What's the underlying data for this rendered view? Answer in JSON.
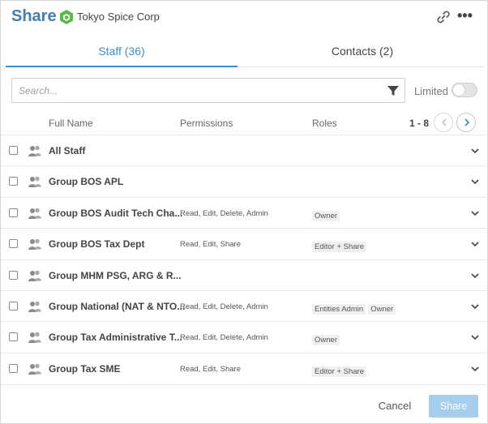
{
  "header": {
    "title": "Share",
    "org_name": "Tokyo Spice Corp",
    "org_icon": "hexagon-icon",
    "link_icon": "link-icon",
    "more_icon": "more-icon",
    "more_glyph": "•••"
  },
  "tabs": [
    {
      "label": "Staff (36)",
      "active": true
    },
    {
      "label": "Contacts (2)",
      "active": false
    }
  ],
  "search": {
    "placeholder": "Search...",
    "value": ""
  },
  "limited": {
    "label": "Limited",
    "on": false
  },
  "columns": {
    "name": "Full Name",
    "permissions": "Permissions",
    "roles": "Roles"
  },
  "pager": {
    "text": "1 - 8"
  },
  "rows": [
    {
      "name": "All Staff",
      "permissions": "",
      "roles": []
    },
    {
      "name": "Group BOS APL",
      "permissions": "",
      "roles": []
    },
    {
      "name": "Group BOS Audit Tech Cha...",
      "permissions": "Read, Edit, Delete, Admin",
      "roles": [
        "Owner"
      ]
    },
    {
      "name": "Group BOS Tax Dept",
      "permissions": "Read, Edit, Share",
      "roles": [
        "Editor + Share"
      ]
    },
    {
      "name": "Group MHM PSG, ARG & R...",
      "permissions": "",
      "roles": []
    },
    {
      "name": "Group National (NAT & NTO...",
      "permissions": "Read, Edit, Delete, Admin",
      "roles": [
        "Entities Admin",
        "Owner"
      ]
    },
    {
      "name": "Group Tax Administrative T...",
      "permissions": "Read, Edit, Delete, Admin",
      "roles": [
        "Owner"
      ]
    },
    {
      "name": "Group Tax SME",
      "permissions": "Read, Edit, Share",
      "roles": [
        "Editor + Share"
      ]
    }
  ],
  "footer": {
    "cancel_label": "Cancel",
    "share_label": "Share"
  },
  "colors": {
    "title": "#3f7fb4",
    "accent": "#3d8ed0",
    "org_icon": "#5cb94c",
    "share_button_disabled": "#a4cdee"
  }
}
